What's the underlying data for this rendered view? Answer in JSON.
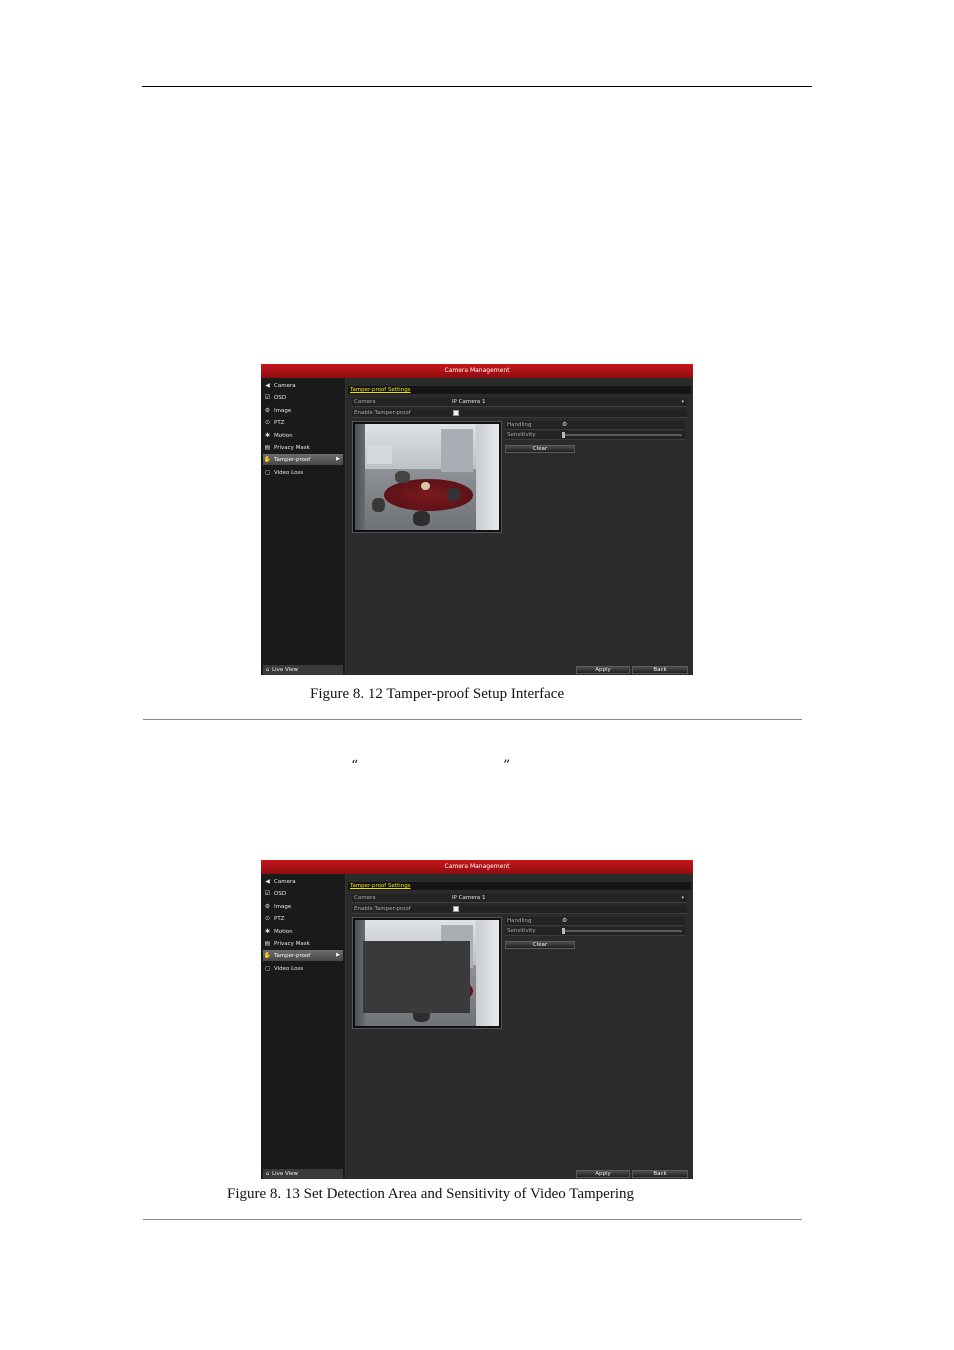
{
  "quote": {
    "open": "“",
    "close": "”"
  },
  "figures": [
    {
      "caption": "Figure 8. 12 Tamper-proof Setup Interface",
      "window_title": "Camera Management",
      "section_title": "Tamper-proof Settings",
      "nav_items": [
        {
          "label": "Camera",
          "icon": "camera-icon",
          "glyph": "◀"
        },
        {
          "label": "OSD",
          "icon": "osd-icon",
          "glyph": "☑"
        },
        {
          "label": "Image",
          "icon": "image-icon",
          "glyph": "⚙"
        },
        {
          "label": "PTZ",
          "icon": "ptz-icon",
          "glyph": "⊙"
        },
        {
          "label": "Motion",
          "icon": "motion-icon",
          "glyph": "✱"
        },
        {
          "label": "Privacy Mask",
          "icon": "privacy-mask-icon",
          "glyph": "▤"
        },
        {
          "label": "Tamper-proof",
          "icon": "tamper-proof-icon",
          "glyph": "✋",
          "active": true
        },
        {
          "label": "Video Loss",
          "icon": "video-loss-icon",
          "glyph": "◻"
        }
      ],
      "live_view": "Live View",
      "camera_label": "Camera",
      "camera_value": "IP Camera 1",
      "enable_label": "Enable Tamper-proof",
      "handling_label": "Handling",
      "sensitivity_label": "Sensitivity",
      "clear_label": "Clear",
      "apply_label": "Apply",
      "back_label": "Back",
      "detection_area_drawn": false
    },
    {
      "caption": "Figure 8. 13 Set Detection Area and Sensitivity of Video Tampering",
      "window_title": "Camera Management",
      "section_title": "Tamper-proof Settings",
      "nav_items": [
        {
          "label": "Camera",
          "icon": "camera-icon",
          "glyph": "◀"
        },
        {
          "label": "OSD",
          "icon": "osd-icon",
          "glyph": "☑"
        },
        {
          "label": "Image",
          "icon": "image-icon",
          "glyph": "⚙"
        },
        {
          "label": "PTZ",
          "icon": "ptz-icon",
          "glyph": "⊙"
        },
        {
          "label": "Motion",
          "icon": "motion-icon",
          "glyph": "✱"
        },
        {
          "label": "Privacy Mask",
          "icon": "privacy-mask-icon",
          "glyph": "▤"
        },
        {
          "label": "Tamper-proof",
          "icon": "tamper-proof-icon",
          "glyph": "✋",
          "active": true
        },
        {
          "label": "Video Loss",
          "icon": "video-loss-icon",
          "glyph": "◻"
        }
      ],
      "live_view": "Live View",
      "camera_label": "Camera",
      "camera_value": "IP Camera 1",
      "enable_label": "Enable Tamper-proof",
      "handling_label": "Handling",
      "sensitivity_label": "Sensitivity",
      "clear_label": "Clear",
      "apply_label": "Apply",
      "back_label": "Back",
      "detection_area_drawn": true
    }
  ],
  "colors": {
    "titlebar": "#b3141a",
    "section_title": "#f3e300",
    "panel": "#262626"
  }
}
